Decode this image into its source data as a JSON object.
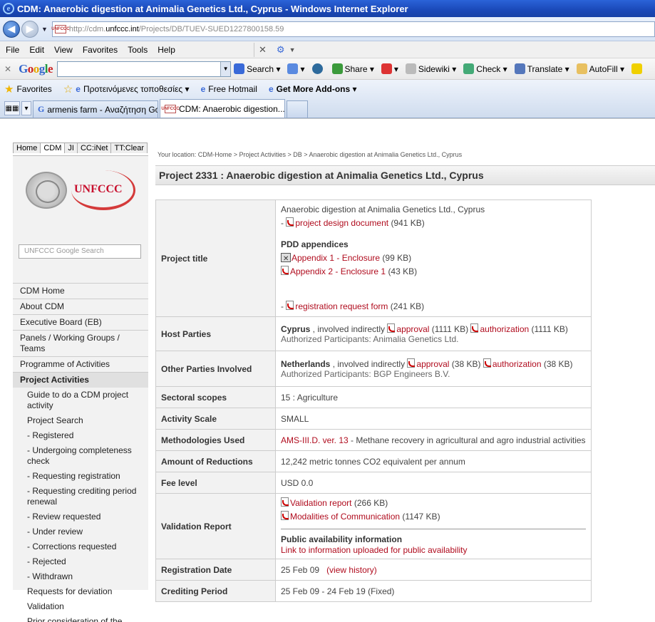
{
  "window": {
    "title": "CDM: Anaerobic digestion at Animalia Genetics Ltd., Cyprus - Windows Internet Explorer"
  },
  "address": {
    "prefix": "http://cdm.",
    "domain": "unfccc.int",
    "path": "/Projects/DB/TUEV-SUED1227800158.59"
  },
  "menu": {
    "file": "File",
    "edit": "Edit",
    "view": "View",
    "favorites": "Favorites",
    "tools": "Tools",
    "help": "Help"
  },
  "google_toolbar": {
    "logo": "Google",
    "search": "Search",
    "share": "Share",
    "sidewiki": "Sidewiki",
    "check": "Check",
    "translate": "Translate",
    "autofill": "AutoFill"
  },
  "favorites_bar": {
    "favorites": "Favorites",
    "suggested": "Προτεινόμενες τοποθεσίες",
    "hotmail": "Free Hotmail",
    "addons": "Get More Add-ons"
  },
  "tabs": [
    {
      "label": "armenis farm - Αναζήτηση Go..."
    },
    {
      "label": "CDM: Anaerobic digestion..."
    }
  ],
  "site_tabs": [
    "Home",
    "CDM",
    "JI",
    "CC:iNet",
    "TT:Clear"
  ],
  "logo_text": "UNFCCC",
  "site_search": {
    "placeholder": "UNFCCC Google Search"
  },
  "nav": {
    "cdm_home": "CDM Home",
    "about": "About CDM",
    "eb": "Executive Board (EB)",
    "panels": "Panels / Working Groups / Teams",
    "poa": "Programme of Activities",
    "project_activities": "Project Activities",
    "guide": "Guide to do a CDM project activity",
    "project_search": "Project Search",
    "registered": "- Registered",
    "undergoing": "- Undergoing completeness check",
    "requesting_reg": "- Requesting registration",
    "requesting_renewal": "- Requesting crediting period renewal",
    "review_requested": "- Review requested",
    "under_review": "- Under review",
    "corrections": "- Corrections requested",
    "rejected": "- Rejected",
    "withdrawn": "- Withdrawn",
    "deviation": "Requests for deviation",
    "validation": "Validation",
    "prior": "Prior consideration of the CDM"
  },
  "breadcrumb": "Your location: CDM-Home  >  Project Activities  >  DB  >  Anaerobic digestion at Animalia Genetics Ltd., Cyprus",
  "project_title": "Project 2331 : Anaerobic digestion at Animalia Genetics Ltd., Cyprus",
  "table": {
    "project_title": {
      "label": "Project title",
      "name": "Anaerobic digestion at Animalia Genetics Ltd., Cyprus",
      "pdd": "project design document",
      "pdd_size": "(941 KB)",
      "appendices_heading": "PDD appendices",
      "app1": "Appendix 1 - Enclosure",
      "app1_size": "(99 KB)",
      "app2": "Appendix 2 - Enclosure 1",
      "app2_size": "(43 KB)",
      "rrf": "registration request form",
      "rrf_size": "(241 KB)"
    },
    "host": {
      "label": "Host Parties",
      "country": "Cyprus",
      "involved": " , involved indirectly ",
      "approval": "approval",
      "approval_size": "(1111 KB)",
      "authorization": "authorization",
      "authorization_size": "(1111 KB)",
      "participants": "Authorized Participants: Animalia Genetics Ltd."
    },
    "other": {
      "label": "Other Parties Involved",
      "country": "Netherlands",
      "involved": " , involved indirectly ",
      "approval": "approval",
      "approval_size": "(38 KB)",
      "authorization": "authorization",
      "authorization_size": "(38 KB)",
      "participants": "Authorized Participants: BGP Engineers B.V."
    },
    "sectoral": {
      "label": "Sectoral scopes",
      "value": "15 : Agriculture"
    },
    "scale": {
      "label": "Activity Scale",
      "value": "SMALL"
    },
    "methodologies": {
      "label": "Methodologies Used",
      "link": "AMS-III.D. ver. 13",
      "value": " - Methane recovery in agricultural and agro industrial activities"
    },
    "reductions": {
      "label": "Amount of Reductions",
      "value": "12,242 metric tonnes CO2 equivalent per annum"
    },
    "fee": {
      "label": "Fee level",
      "value": "USD 0.0"
    },
    "validation": {
      "label": "Validation Report",
      "report": "Validation report",
      "report_size": "(266 KB)",
      "modalities": "Modalities of Communication",
      "modalities_size": "(1147 KB)",
      "public_heading": "Public availability information",
      "public_link": "Link to information uploaded for public availability"
    },
    "registration": {
      "label": "Registration Date",
      "value": "25 Feb 09",
      "history": "(view history)"
    },
    "crediting": {
      "label": "Crediting Period",
      "value": "25 Feb 09 - 24 Feb 19 (Fixed)"
    }
  }
}
